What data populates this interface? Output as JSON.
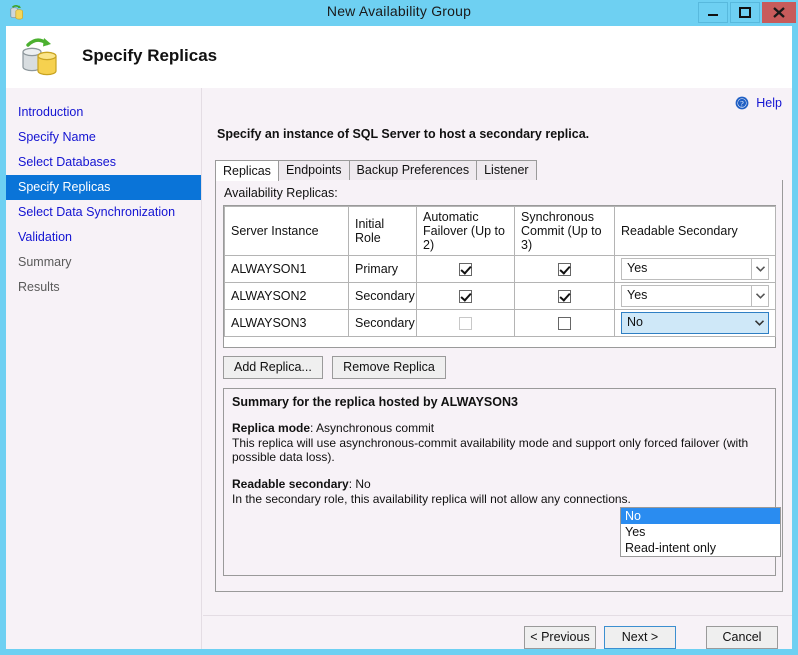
{
  "window": {
    "title": "New Availability Group",
    "icon": "availability-group-icon",
    "controls": {
      "minimize": "minimize-icon",
      "maximize": "maximize-icon",
      "close": "close-icon"
    }
  },
  "header": {
    "title": "Specify Replicas",
    "icon": "databases-sync-icon"
  },
  "sidebar": {
    "items": [
      {
        "label": "Introduction",
        "state": "link"
      },
      {
        "label": "Specify Name",
        "state": "link"
      },
      {
        "label": "Select Databases",
        "state": "link"
      },
      {
        "label": "Specify Replicas",
        "state": "active"
      },
      {
        "label": "Select Data Synchronization",
        "state": "link"
      },
      {
        "label": "Validation",
        "state": "link"
      },
      {
        "label": "Summary",
        "state": "muted"
      },
      {
        "label": "Results",
        "state": "muted"
      }
    ]
  },
  "content": {
    "help_label": "Help",
    "help_icon": "help-circle-icon",
    "instruction": "Specify an instance of SQL Server to host a secondary replica.",
    "tabs": [
      {
        "label": "Replicas",
        "selected": true
      },
      {
        "label": "Endpoints",
        "selected": false
      },
      {
        "label": "Backup Preferences",
        "selected": false
      },
      {
        "label": "Listener",
        "selected": false
      }
    ],
    "grid_label": "Availability Replicas:",
    "grid": {
      "columns": [
        "Server Instance",
        "Initial Role",
        "Automatic Failover (Up to 2)",
        "Synchronous Commit (Up to 3)",
        "Readable Secondary"
      ],
      "rows": [
        {
          "server_instance": "ALWAYSON1",
          "initial_role": "Primary",
          "automatic_failover": true,
          "automatic_failover_enabled": true,
          "synchronous_commit": true,
          "synchronous_commit_enabled": true,
          "readable_secondary": "Yes",
          "readable_secondary_open": false
        },
        {
          "server_instance": "ALWAYSON2",
          "initial_role": "Secondary",
          "automatic_failover": true,
          "automatic_failover_enabled": true,
          "synchronous_commit": true,
          "synchronous_commit_enabled": true,
          "readable_secondary": "Yes",
          "readable_secondary_open": false
        },
        {
          "server_instance": "ALWAYSON3",
          "initial_role": "Secondary",
          "automatic_failover": false,
          "automatic_failover_enabled": false,
          "synchronous_commit": false,
          "synchronous_commit_enabled": false,
          "readable_secondary": "No",
          "readable_secondary_open": true
        }
      ]
    },
    "dropdown": {
      "options": [
        {
          "label": "No",
          "selected": true
        },
        {
          "label": "Yes",
          "selected": false
        },
        {
          "label": "Read-intent only",
          "selected": false
        }
      ]
    },
    "grid_actions": {
      "add_replica": "Add Replica...",
      "remove_replica": "Remove Replica"
    },
    "summary": {
      "title": "Summary for the replica hosted by ALWAYSON3",
      "entries": [
        {
          "label": "Replica mode",
          "value": "Asynchronous commit",
          "description": "This replica will use asynchronous-commit availability mode and support only forced failover (with possible data loss)."
        },
        {
          "label": "Readable secondary",
          "value": "No",
          "description": "In the secondary role, this availability replica will not allow any connections."
        }
      ]
    }
  },
  "footer": {
    "previous": "< Previous",
    "next": "Next >",
    "cancel": "Cancel"
  },
  "colors": {
    "titlebar": "#6ed0f2",
    "accent_selection": "#0a74d8",
    "dropdown_highlight": "#2a8cf0",
    "link": "#1414d2",
    "close_button": "#c75b5b",
    "dialog_background": "#f7f2f7"
  }
}
